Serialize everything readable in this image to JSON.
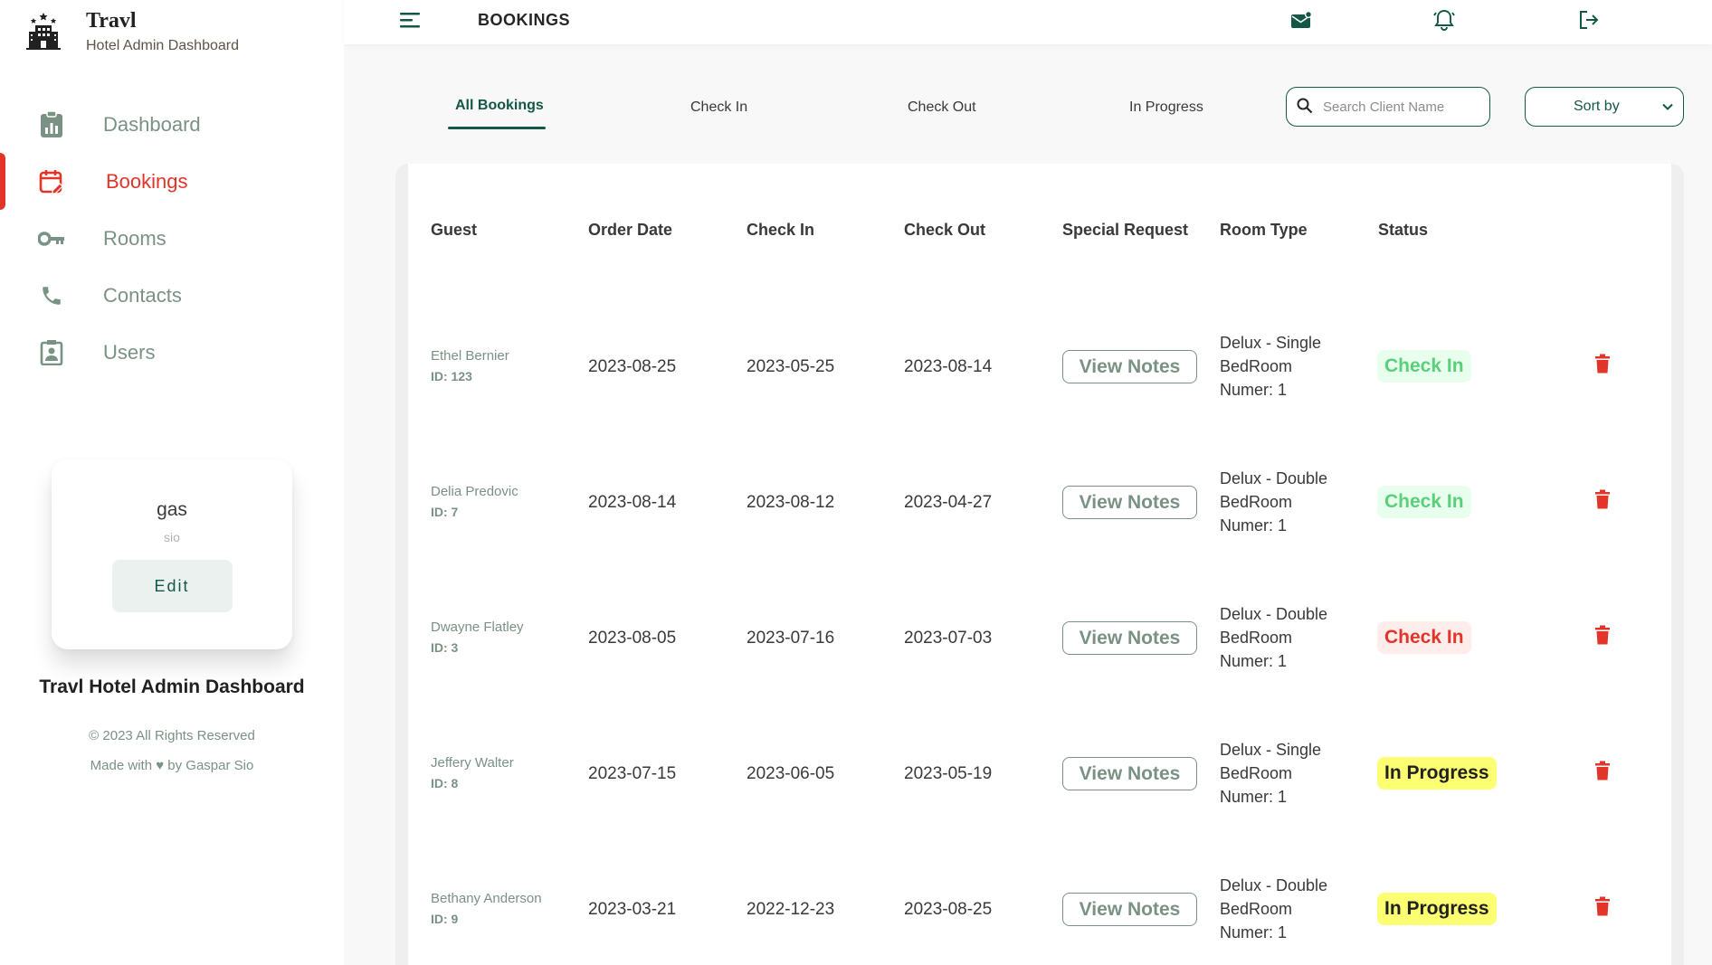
{
  "brand": {
    "title": "Travl",
    "subtitle": "Hotel Admin Dashboard"
  },
  "nav": [
    {
      "label": "Dashboard",
      "icon": "dashboard-icon"
    },
    {
      "label": "Bookings",
      "icon": "calendar-edit-icon",
      "active": true
    },
    {
      "label": "Rooms",
      "icon": "key-icon"
    },
    {
      "label": "Contacts",
      "icon": "phone-icon"
    },
    {
      "label": "Users",
      "icon": "user-badge-icon"
    }
  ],
  "profile": {
    "name": "gas",
    "sub": "sio",
    "edit_label": "Edit"
  },
  "sidebar_footer": {
    "title": "Travl Hotel Admin Dashboard",
    "copyright": "© 2023 All Rights Reserved",
    "made_with": "Made with ♥ by Gaspar Sio"
  },
  "topbar": {
    "title": "BOOKINGS",
    "icons": [
      "menu-icon",
      "mail-icon",
      "bell-icon",
      "logout-icon"
    ]
  },
  "filters": {
    "tabs": [
      {
        "label": "All Bookings",
        "active": true
      },
      {
        "label": "Check In"
      },
      {
        "label": "Check Out"
      },
      {
        "label": "In Progress"
      }
    ],
    "search_placeholder": "Search Client Name",
    "sort_label": "Sort by"
  },
  "table": {
    "headers": [
      "Guest",
      "Order Date",
      "Check In",
      "Check Out",
      "Special Request",
      "Room Type",
      "Status"
    ],
    "notes_label": "View Notes",
    "rows": [
      {
        "guest": "Ethel Bernier",
        "id": "ID: 123",
        "order_date": "2023-08-25",
        "check_in": "2023-05-25",
        "check_out": "2023-08-14",
        "room_line1": "Delux - Single",
        "room_line2": "BedRoom",
        "room_line3": "Numer: 1",
        "status": "Check In",
        "status_color": "green"
      },
      {
        "guest": "Delia Predovic",
        "id": "ID: 7",
        "order_date": "2023-08-14",
        "check_in": "2023-08-12",
        "check_out": "2023-04-27",
        "room_line1": "Delux - Double",
        "room_line2": "BedRoom",
        "room_line3": "Numer: 1",
        "status": "Check In",
        "status_color": "green"
      },
      {
        "guest": "Dwayne Flatley",
        "id": "ID: 3",
        "order_date": "2023-08-05",
        "check_in": "2023-07-16",
        "check_out": "2023-07-03",
        "room_line1": "Delux - Double",
        "room_line2": "BedRoom",
        "room_line3": "Numer: 1",
        "status": "Check In",
        "status_color": "red"
      },
      {
        "guest": "Jeffery Walter",
        "id": "ID: 8",
        "order_date": "2023-07-15",
        "check_in": "2023-06-05",
        "check_out": "2023-05-19",
        "room_line1": "Delux - Single",
        "room_line2": "BedRoom",
        "room_line3": "Numer: 1",
        "status": "In Progress",
        "status_color": "yellow"
      },
      {
        "guest": "Bethany Anderson",
        "id": "ID: 9",
        "order_date": "2023-03-21",
        "check_in": "2022-12-23",
        "check_out": "2023-08-25",
        "room_line1": "Delux - Double",
        "room_line2": "BedRoom",
        "room_line3": "Numer: 1",
        "status": "In Progress",
        "status_color": "yellow"
      }
    ]
  },
  "colors": {
    "accent_green": "#135846",
    "muted_green": "#799283",
    "active_red": "#e23428",
    "status_green": "#5ad07a",
    "status_yellow": "#fcff71"
  }
}
